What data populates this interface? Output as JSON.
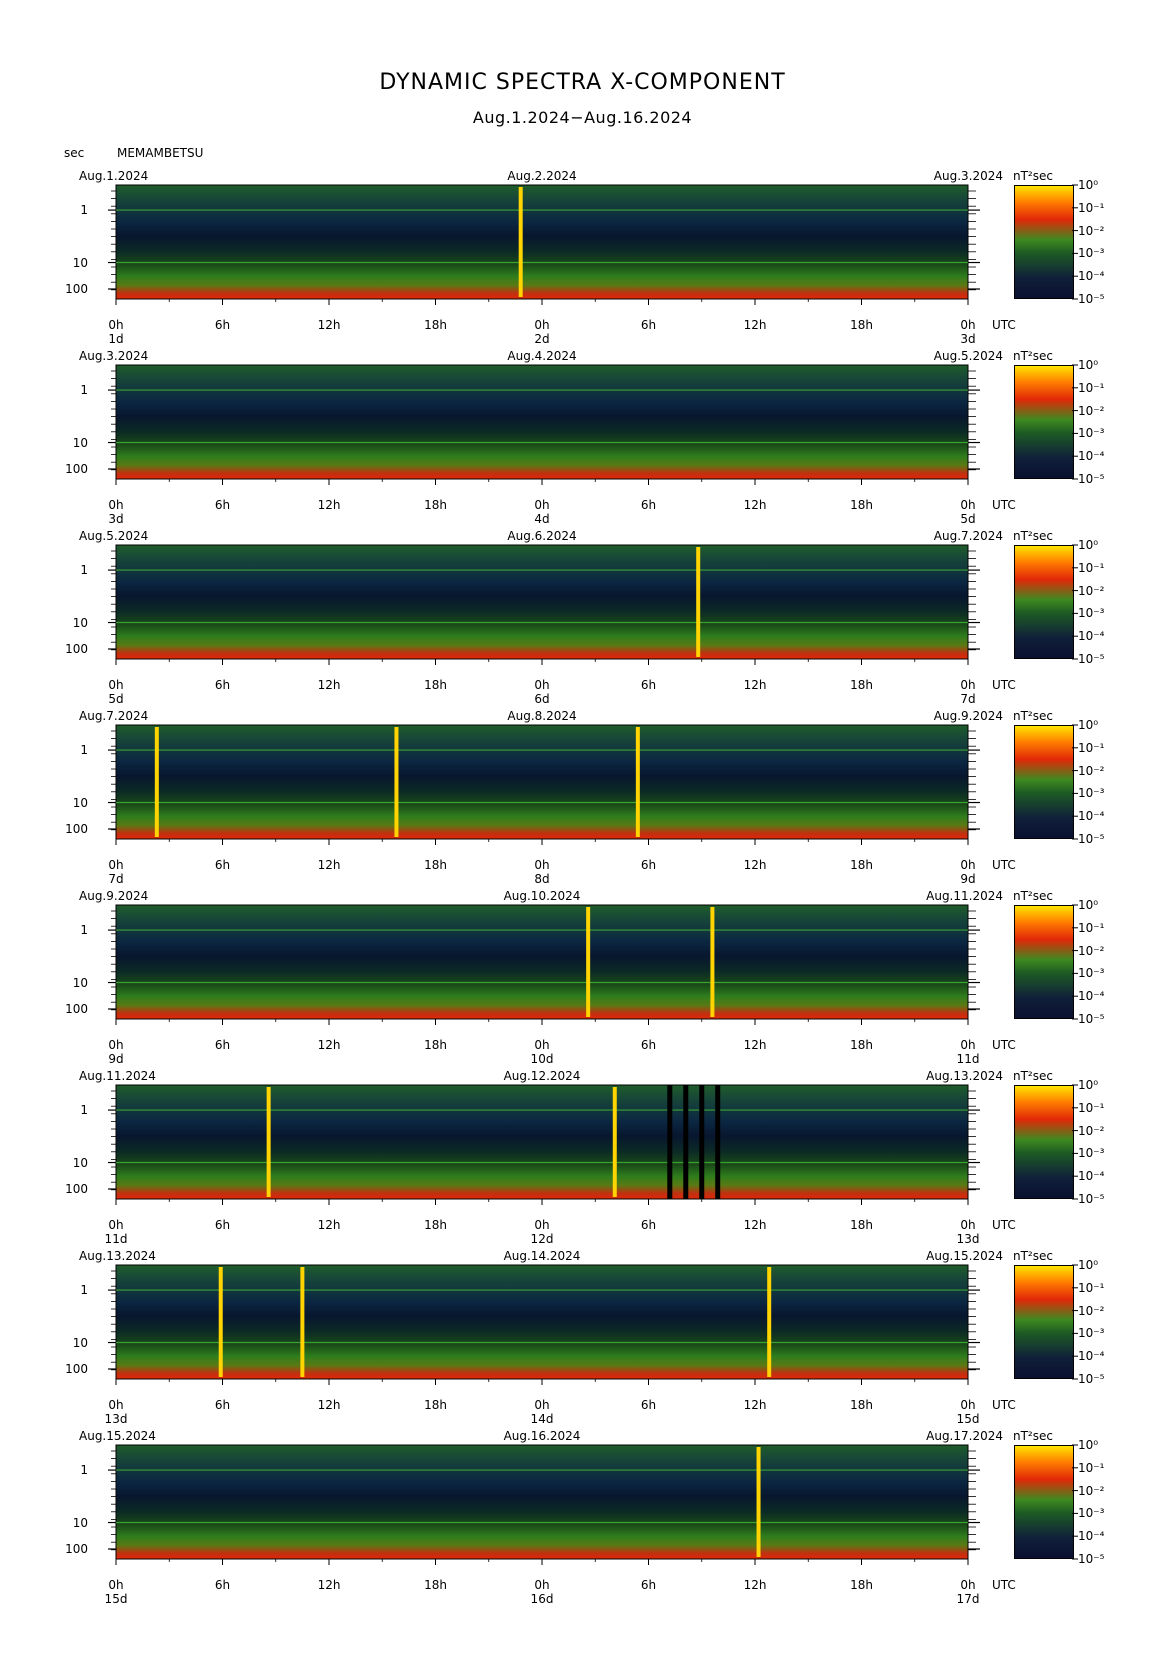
{
  "title": "DYNAMIC SPECTRA X-COMPONENT",
  "subtitle": "Aug.1.2024−Aug.16.2024",
  "y_unit_label": "sec",
  "station": "MEMAMBETSU",
  "power_unit": "nT²sec",
  "utc_label": "UTC",
  "colors": {
    "low": "#0a1030",
    "mid": "#2e7d1c",
    "high": "#e02808",
    "peak": "#ffe400"
  },
  "chart_data": {
    "type": "heatmap",
    "title": "DYNAMIC SPECTRA X-COMPONENT",
    "subtitle": "Aug.1.2024−Aug.16.2024",
    "ylabel": "sec",
    "y_scale": "log",
    "y_ticks": [
      "1",
      "10",
      "100"
    ],
    "x_ticks": [
      "0h",
      "6h",
      "12h",
      "18h",
      "0h",
      "6h",
      "12h",
      "18h",
      "0h"
    ],
    "colorbar_label": "nT²sec",
    "colorbar_ticks": [
      "10⁰",
      "10⁻¹",
      "10⁻²",
      "10⁻³",
      "10⁻⁴",
      "10⁻⁵"
    ],
    "panels": [
      {
        "date_left": "Aug.1.2024",
        "date_mid": "Aug.2.2024",
        "date_right": "Aug.3.2024",
        "day_labels": [
          "1d",
          "2d",
          "3d"
        ],
        "spikes": [
          22.8
        ]
      },
      {
        "date_left": "Aug.3.2024",
        "date_mid": "Aug.4.2024",
        "date_right": "Aug.5.2024",
        "day_labels": [
          "3d",
          "4d",
          "5d"
        ],
        "spikes": []
      },
      {
        "date_left": "Aug.5.2024",
        "date_mid": "Aug.6.2024",
        "date_right": "Aug.7.2024",
        "day_labels": [
          "5d",
          "6d",
          "7d"
        ],
        "spikes": [
          32.8
        ]
      },
      {
        "date_left": "Aug.7.2024",
        "date_mid": "Aug.8.2024",
        "date_right": "Aug.9.2024",
        "day_labels": [
          "7d",
          "8d",
          "9d"
        ],
        "spikes": [
          2.3,
          15.8,
          29.4
        ]
      },
      {
        "date_left": "Aug.9.2024",
        "date_mid": "Aug.10.2024",
        "date_right": "Aug.11.2024",
        "day_labels": [
          "9d",
          "10d",
          "11d"
        ],
        "spikes": [
          26.6,
          33.6
        ]
      },
      {
        "date_left": "Aug.11.2024",
        "date_mid": "Aug.12.2024",
        "date_right": "Aug.13.2024",
        "day_labels": [
          "11d",
          "12d",
          "13d"
        ],
        "spikes": [
          8.6,
          28.1
        ],
        "gaps": [
          31.2,
          32.1,
          33.0,
          33.9
        ]
      },
      {
        "date_left": "Aug.13.2024",
        "date_mid": "Aug.14.2024",
        "date_right": "Aug.15.2024",
        "day_labels": [
          "13d",
          "14d",
          "15d"
        ],
        "spikes": [
          5.9,
          10.5,
          36.8
        ]
      },
      {
        "date_left": "Aug.15.2024",
        "date_mid": "Aug.16.2024",
        "date_right": "Aug.17.2024",
        "day_labels": [
          "15d",
          "16d",
          "17d"
        ],
        "spikes": [
          36.2
        ]
      }
    ]
  }
}
